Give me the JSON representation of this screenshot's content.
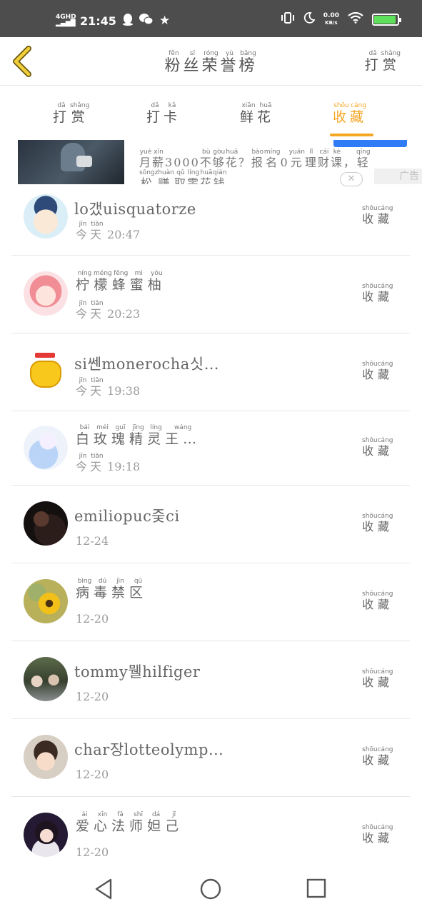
{
  "status_bar": {
    "network": "4GHD",
    "time": "21:45",
    "speed_value": "0.00",
    "speed_unit": "KB/s",
    "icons": [
      "qq-icon",
      "wechat-icon",
      "star-icon",
      "vibrate-icon",
      "moon-icon",
      "wifi-icon",
      "battery-icon"
    ],
    "battery_color": "#5ee05a"
  },
  "header": {
    "title": [
      {
        "char": "粉",
        "pinyin": "fěn"
      },
      {
        "char": "丝",
        "pinyin": "sī"
      },
      {
        "char": "荣",
        "pinyin": "róng"
      },
      {
        "char": "誉",
        "pinyin": "yù"
      },
      {
        "char": "榜",
        "pinyin": "bǎng"
      }
    ],
    "action": [
      {
        "char": "打",
        "pinyin": "dǎ"
      },
      {
        "char": "赏",
        "pinyin": "shǎng"
      }
    ],
    "back_icon": "chevron-left-icon",
    "accent_color": "#f5a623"
  },
  "tabs": [
    {
      "chars": [
        {
          "char": "打",
          "pinyin": "dǎ"
        },
        {
          "char": "赏",
          "pinyin": "shǎng"
        }
      ],
      "active": false
    },
    {
      "chars": [
        {
          "char": "打",
          "pinyin": "dǎ"
        },
        {
          "char": "卡",
          "pinyin": "kǎ"
        }
      ],
      "active": false
    },
    {
      "chars": [
        {
          "char": "鲜",
          "pinyin": "xiān"
        },
        {
          "char": "花",
          "pinyin": "huā"
        }
      ],
      "active": false
    },
    {
      "chars": [
        {
          "char": "收",
          "pinyin": "shōu"
        },
        {
          "char": "藏",
          "pinyin": "cáng"
        }
      ],
      "active": true
    }
  ],
  "ad": {
    "line": [
      {
        "char": "月",
        "pinyin": "yuè"
      },
      {
        "char": "薪",
        "pinyin": "xīn"
      },
      {
        "char": "3000",
        "pinyin": ""
      },
      {
        "char": "不",
        "pinyin": "bù"
      },
      {
        "char": "够",
        "pinyin": "gòu"
      },
      {
        "char": "花",
        "pinyin": "huā"
      },
      {
        "char": "？",
        "pinyin": ""
      },
      {
        "char": "报",
        "pinyin": "bào"
      },
      {
        "char": "名",
        "pinyin": "míng"
      },
      {
        "char": "0",
        "pinyin": ""
      },
      {
        "char": "元",
        "pinyin": "yuán"
      },
      {
        "char": "理",
        "pinyin": "lǐ"
      },
      {
        "char": "财",
        "pinyin": "cái"
      },
      {
        "char": "课",
        "pinyin": "kè"
      },
      {
        "char": "，",
        "pinyin": ""
      },
      {
        "char": "轻",
        "pinyin": "qīng"
      }
    ],
    "line2": [
      {
        "char": "松",
        "pinyin": "sōng"
      },
      {
        "char": "赚",
        "pinyin": "zhuàn"
      },
      {
        "char": "取",
        "pinyin": "qǔ"
      },
      {
        "char": "零",
        "pinyin": "líng"
      },
      {
        "char": "花",
        "pinyin": "huā"
      },
      {
        "char": "钱",
        "pinyin": "qián"
      }
    ],
    "label": "广告",
    "close_icon": "close-icon"
  },
  "fav_label": [
    {
      "char": "收",
      "pinyin": "shōu"
    },
    {
      "char": "藏",
      "pinyin": "cáng"
    }
  ],
  "today_label": [
    {
      "char": "今",
      "pinyin": "jīn"
    },
    {
      "char": "天",
      "pinyin": "tiān"
    }
  ],
  "entries": [
    {
      "name": "lo갰uisquatorze",
      "date": "今天",
      "time": "20:47"
    },
    {
      "name_chars": [
        {
          "char": "柠",
          "pinyin": "níng"
        },
        {
          "char": "檬",
          "pinyin": "méng"
        },
        {
          "char": "蜂",
          "pinyin": "fēng"
        },
        {
          "char": "蜜",
          "pinyin": "mì"
        },
        {
          "char": "柚",
          "pinyin": "yòu"
        }
      ],
      "date": "今天",
      "time": "20:23"
    },
    {
      "name": "si쎈monerocha싯…",
      "date": "今天",
      "time": "19:38"
    },
    {
      "name_chars": [
        {
          "char": "白",
          "pinyin": "bái"
        },
        {
          "char": "玫",
          "pinyin": "méi"
        },
        {
          "char": "瑰",
          "pinyin": "guī"
        },
        {
          "char": "精",
          "pinyin": "jīng"
        },
        {
          "char": "灵",
          "pinyin": "líng"
        },
        {
          "char": "王…",
          "pinyin": "wáng"
        }
      ],
      "date": "今天",
      "time": "19:18"
    },
    {
      "name": "emiliopuc줒ci",
      "time": "12-24"
    },
    {
      "name_chars": [
        {
          "char": "病",
          "pinyin": "bìng"
        },
        {
          "char": "毒",
          "pinyin": "dú"
        },
        {
          "char": "禁",
          "pinyin": "jìn"
        },
        {
          "char": "区",
          "pinyin": "qū"
        }
      ],
      "time": "12-20"
    },
    {
      "name": "tommy뭴hilfiger",
      "time": "12-20"
    },
    {
      "name": "char장lotteolymp…",
      "time": "12-20"
    },
    {
      "name_chars": [
        {
          "char": "爱",
          "pinyin": "ài"
        },
        {
          "char": "心",
          "pinyin": "xīn"
        },
        {
          "char": "法",
          "pinyin": "fǎ"
        },
        {
          "char": "师",
          "pinyin": "shī"
        },
        {
          "char": "妲",
          "pinyin": "dá"
        },
        {
          "char": "己",
          "pinyin": "jǐ"
        }
      ],
      "time": "12-20"
    }
  ],
  "navbar": {
    "icons": [
      "back-triangle-icon",
      "home-circle-icon",
      "recents-square-icon"
    ]
  }
}
